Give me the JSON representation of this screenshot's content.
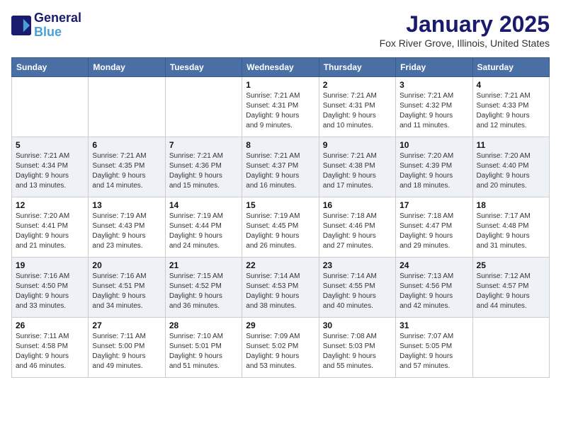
{
  "header": {
    "logo_line1": "General",
    "logo_line2": "Blue",
    "month": "January 2025",
    "location": "Fox River Grove, Illinois, United States"
  },
  "weekdays": [
    "Sunday",
    "Monday",
    "Tuesday",
    "Wednesday",
    "Thursday",
    "Friday",
    "Saturday"
  ],
  "weeks": [
    [
      {
        "day": "",
        "info": ""
      },
      {
        "day": "",
        "info": ""
      },
      {
        "day": "",
        "info": ""
      },
      {
        "day": "1",
        "info": "Sunrise: 7:21 AM\nSunset: 4:31 PM\nDaylight: 9 hours\nand 9 minutes."
      },
      {
        "day": "2",
        "info": "Sunrise: 7:21 AM\nSunset: 4:31 PM\nDaylight: 9 hours\nand 10 minutes."
      },
      {
        "day": "3",
        "info": "Sunrise: 7:21 AM\nSunset: 4:32 PM\nDaylight: 9 hours\nand 11 minutes."
      },
      {
        "day": "4",
        "info": "Sunrise: 7:21 AM\nSunset: 4:33 PM\nDaylight: 9 hours\nand 12 minutes."
      }
    ],
    [
      {
        "day": "5",
        "info": "Sunrise: 7:21 AM\nSunset: 4:34 PM\nDaylight: 9 hours\nand 13 minutes."
      },
      {
        "day": "6",
        "info": "Sunrise: 7:21 AM\nSunset: 4:35 PM\nDaylight: 9 hours\nand 14 minutes."
      },
      {
        "day": "7",
        "info": "Sunrise: 7:21 AM\nSunset: 4:36 PM\nDaylight: 9 hours\nand 15 minutes."
      },
      {
        "day": "8",
        "info": "Sunrise: 7:21 AM\nSunset: 4:37 PM\nDaylight: 9 hours\nand 16 minutes."
      },
      {
        "day": "9",
        "info": "Sunrise: 7:21 AM\nSunset: 4:38 PM\nDaylight: 9 hours\nand 17 minutes."
      },
      {
        "day": "10",
        "info": "Sunrise: 7:20 AM\nSunset: 4:39 PM\nDaylight: 9 hours\nand 18 minutes."
      },
      {
        "day": "11",
        "info": "Sunrise: 7:20 AM\nSunset: 4:40 PM\nDaylight: 9 hours\nand 20 minutes."
      }
    ],
    [
      {
        "day": "12",
        "info": "Sunrise: 7:20 AM\nSunset: 4:41 PM\nDaylight: 9 hours\nand 21 minutes."
      },
      {
        "day": "13",
        "info": "Sunrise: 7:19 AM\nSunset: 4:43 PM\nDaylight: 9 hours\nand 23 minutes."
      },
      {
        "day": "14",
        "info": "Sunrise: 7:19 AM\nSunset: 4:44 PM\nDaylight: 9 hours\nand 24 minutes."
      },
      {
        "day": "15",
        "info": "Sunrise: 7:19 AM\nSunset: 4:45 PM\nDaylight: 9 hours\nand 26 minutes."
      },
      {
        "day": "16",
        "info": "Sunrise: 7:18 AM\nSunset: 4:46 PM\nDaylight: 9 hours\nand 27 minutes."
      },
      {
        "day": "17",
        "info": "Sunrise: 7:18 AM\nSunset: 4:47 PM\nDaylight: 9 hours\nand 29 minutes."
      },
      {
        "day": "18",
        "info": "Sunrise: 7:17 AM\nSunset: 4:48 PM\nDaylight: 9 hours\nand 31 minutes."
      }
    ],
    [
      {
        "day": "19",
        "info": "Sunrise: 7:16 AM\nSunset: 4:50 PM\nDaylight: 9 hours\nand 33 minutes."
      },
      {
        "day": "20",
        "info": "Sunrise: 7:16 AM\nSunset: 4:51 PM\nDaylight: 9 hours\nand 34 minutes."
      },
      {
        "day": "21",
        "info": "Sunrise: 7:15 AM\nSunset: 4:52 PM\nDaylight: 9 hours\nand 36 minutes."
      },
      {
        "day": "22",
        "info": "Sunrise: 7:14 AM\nSunset: 4:53 PM\nDaylight: 9 hours\nand 38 minutes."
      },
      {
        "day": "23",
        "info": "Sunrise: 7:14 AM\nSunset: 4:55 PM\nDaylight: 9 hours\nand 40 minutes."
      },
      {
        "day": "24",
        "info": "Sunrise: 7:13 AM\nSunset: 4:56 PM\nDaylight: 9 hours\nand 42 minutes."
      },
      {
        "day": "25",
        "info": "Sunrise: 7:12 AM\nSunset: 4:57 PM\nDaylight: 9 hours\nand 44 minutes."
      }
    ],
    [
      {
        "day": "26",
        "info": "Sunrise: 7:11 AM\nSunset: 4:58 PM\nDaylight: 9 hours\nand 46 minutes."
      },
      {
        "day": "27",
        "info": "Sunrise: 7:11 AM\nSunset: 5:00 PM\nDaylight: 9 hours\nand 49 minutes."
      },
      {
        "day": "28",
        "info": "Sunrise: 7:10 AM\nSunset: 5:01 PM\nDaylight: 9 hours\nand 51 minutes."
      },
      {
        "day": "29",
        "info": "Sunrise: 7:09 AM\nSunset: 5:02 PM\nDaylight: 9 hours\nand 53 minutes."
      },
      {
        "day": "30",
        "info": "Sunrise: 7:08 AM\nSunset: 5:03 PM\nDaylight: 9 hours\nand 55 minutes."
      },
      {
        "day": "31",
        "info": "Sunrise: 7:07 AM\nSunset: 5:05 PM\nDaylight: 9 hours\nand 57 minutes."
      },
      {
        "day": "",
        "info": ""
      }
    ]
  ]
}
